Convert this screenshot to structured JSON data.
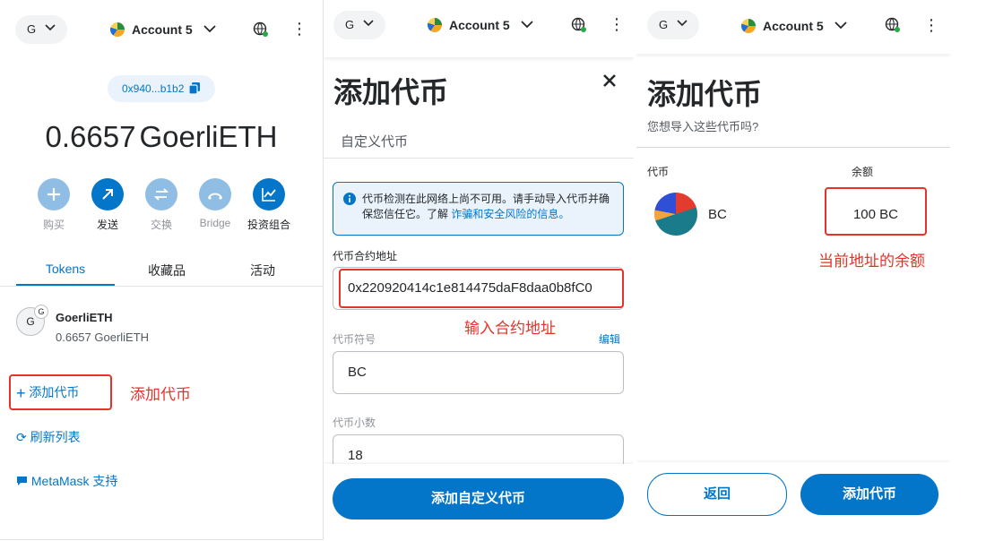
{
  "colors": {
    "accent": "#0376c9",
    "annotation": "#e5332a",
    "disabled": "#8fbde4"
  },
  "common": {
    "network_initial": "G",
    "account_name": "Account 5"
  },
  "panel1": {
    "address": "0x940...b1b2",
    "balance": "0.6657",
    "balance_unit": "GoerliETH",
    "actions": [
      {
        "label": "购买",
        "icon": "plus-icon",
        "enabled": false
      },
      {
        "label": "发送",
        "icon": "send-arrow-icon",
        "enabled": true
      },
      {
        "label": "交换",
        "icon": "swap-icon",
        "enabled": false
      },
      {
        "label": "Bridge",
        "icon": "bridge-icon",
        "enabled": false
      },
      {
        "label": "投资组合",
        "icon": "chart-icon",
        "enabled": true
      }
    ],
    "tabs": [
      "Tokens",
      "收藏品",
      "活动"
    ],
    "token": {
      "avatar": "G",
      "badge": "G",
      "name": "GoerliETH",
      "amount": "0.6657 GoerliETH"
    },
    "add_token": "添加代币",
    "add_token_note": "添加代币",
    "refresh": "刷新列表",
    "support": "MetaMask 支持"
  },
  "panel2": {
    "title": "添加代币",
    "tab": "自定义代币",
    "info": "代币检测在此网络上尚不可用。请手动导入代币并确保您信任它。了解",
    "info_link": "诈骗和安全风险的信息。",
    "address_label": "代币合约地址",
    "address_value": "0x220920414c1e814475daF8daa0b8fC0",
    "address_note": "输入合约地址",
    "symbol_label": "代币符号",
    "edit": "编辑",
    "symbol_value": "BC",
    "decimals_label": "代币小数",
    "decimals_value": "18",
    "submit": "添加自定义代币"
  },
  "panel3": {
    "title": "添加代币",
    "subtitle": "您想导入这些代币吗?",
    "col_token": "代币",
    "col_balance": "余额",
    "token_name": "BC",
    "balance": "100 BC",
    "balance_note": "当前地址的余额",
    "back": "返回",
    "add": "添加代币"
  }
}
